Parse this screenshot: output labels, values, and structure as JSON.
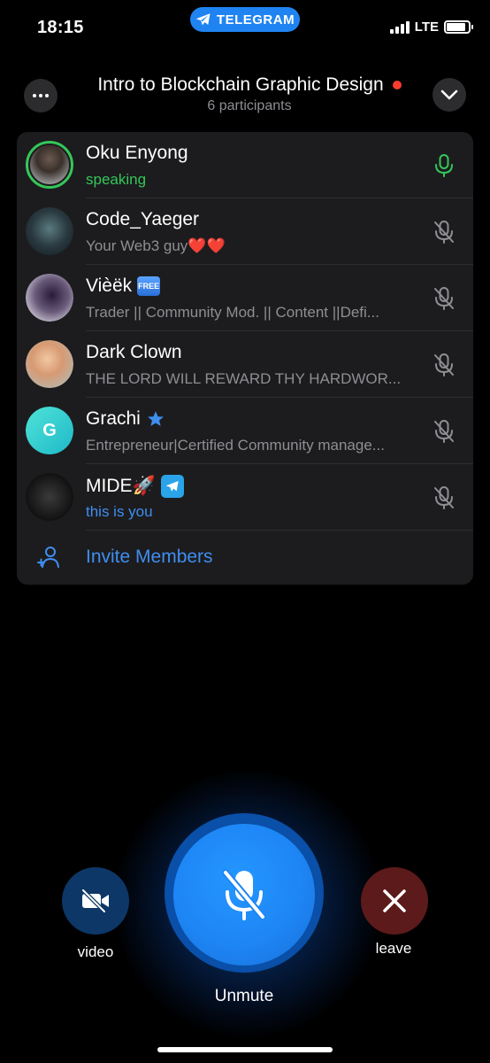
{
  "status_bar": {
    "time": "18:15",
    "app_pill": "TELEGRAM",
    "network": "LTE"
  },
  "header": {
    "title": "Intro to Blockchain Graphic Design",
    "subtitle": "6 participants",
    "more_icon": "more-horizontal-icon",
    "collapse_icon": "chevron-down-icon"
  },
  "participants": [
    {
      "name": "Oku Enyong",
      "about": "speaking",
      "about_style": "green",
      "speaking": true,
      "mic": "mic-on"
    },
    {
      "name": "Code_Yaeger",
      "about": "Your Web3 guy❤️❤️",
      "about_style": "gray",
      "speaking": false,
      "mic": "mic-off"
    },
    {
      "name": "Vièëk",
      "badge": "FREE",
      "about": "Trader || Community Mod. || Content ||Defi...",
      "about_style": "gray",
      "speaking": false,
      "mic": "mic-off"
    },
    {
      "name": "Dark Clown",
      "about": "THE LORD WILL REWARD THY HARDWOR...",
      "about_style": "gray",
      "speaking": false,
      "mic": "mic-off"
    },
    {
      "name": "Grachi",
      "avatar_letter": "G",
      "about": "Entrepreneur|Certified Community manage...",
      "about_style": "gray",
      "speaking": false,
      "mic": "mic-off"
    },
    {
      "name": "MIDE🚀",
      "about": "this is you",
      "about_style": "blue",
      "speaking": false,
      "mic": "mic-off"
    }
  ],
  "invite": {
    "label": "Invite Members"
  },
  "controls": {
    "video_label": "video",
    "leave_label": "leave",
    "main_label": "Unmute"
  },
  "colors": {
    "accent": "#1e86f5",
    "speaking": "#34c759",
    "link": "#3f8ef0",
    "panel": "#1c1c1e",
    "leave": "#5c1a1a"
  }
}
